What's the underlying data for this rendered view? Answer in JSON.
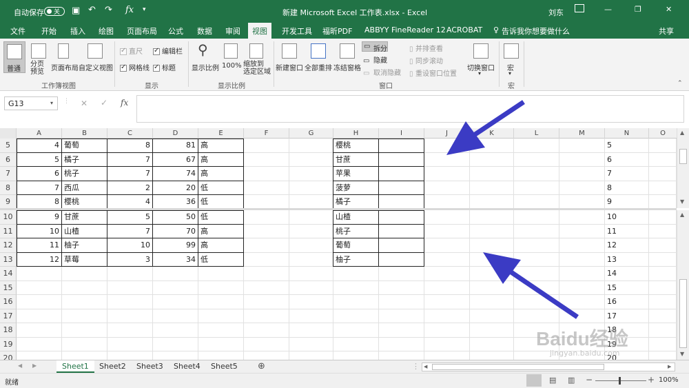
{
  "window": {
    "autosave_label": "自动保存",
    "autosave_state": "关",
    "title": "新建 Microsoft Excel 工作表.xlsx - Excel",
    "user": "刘东",
    "minimize": "—",
    "restore": "❐",
    "close": "✕"
  },
  "tabs": [
    "文件",
    "开始",
    "插入",
    "绘图",
    "页面布局",
    "公式",
    "数据",
    "审阅",
    "视图",
    "开发工具",
    "福昕PDF",
    "ABBYY FineReader 12",
    "ACROBAT"
  ],
  "tell_me": "告诉我你想要做什么",
  "share": "共享",
  "ribbon": {
    "views": {
      "normal": "普通",
      "page_break": "分页\n预览",
      "page_layout": "页面布局",
      "custom": "自定义视图",
      "group": "工作簿视图"
    },
    "show": {
      "ruler": "直尺",
      "formula_bar": "编辑栏",
      "gridlines": "网格线",
      "headings": "标题",
      "group": "显示"
    },
    "zoom": {
      "zoom": "显示比例",
      "zoom100": "100%",
      "zoom_sel": "缩放到\n选定区域",
      "group": "显示比例"
    },
    "window": {
      "new": "新建窗口",
      "arrange": "全部重排",
      "freeze": "冻结窗格",
      "split": "拆分",
      "hide": "隐藏",
      "unhide": "取消隐藏",
      "side": "并排查看",
      "sync": "同步滚动",
      "reset": "重设窗口位置",
      "switch": "切换窗口",
      "group": "窗口"
    },
    "macro": {
      "macro": "宏",
      "group": "宏"
    }
  },
  "formula": {
    "namebox": "G13",
    "cancel": "✕",
    "enter": "✓",
    "fx": "fx",
    "value": ""
  },
  "columns": [
    "A",
    "B",
    "C",
    "D",
    "E",
    "F",
    "G",
    "H",
    "I",
    "J",
    "K",
    "L",
    "M",
    "N",
    "O"
  ],
  "top_rows": [
    {
      "n": "5",
      "a": "4",
      "b": "葡萄",
      "c": "8",
      "d": "81",
      "e": "高",
      "h": "樱桃"
    },
    {
      "n": "6",
      "a": "5",
      "b": "橘子",
      "c": "7",
      "d": "67",
      "e": "高",
      "h": "甘蔗"
    },
    {
      "n": "7",
      "a": "6",
      "b": "桃子",
      "c": "7",
      "d": "74",
      "e": "高",
      "h": "苹果"
    },
    {
      "n": "8",
      "a": "7",
      "b": "西瓜",
      "c": "2",
      "d": "20",
      "e": "低",
      "h": "菠萝"
    },
    {
      "n": "9",
      "a": "8",
      "b": "樱桃",
      "c": "4",
      "d": "36",
      "e": "低",
      "h": "橘子"
    }
  ],
  "bottom_rows": [
    {
      "n": "10",
      "a": "9",
      "b": "甘蔗",
      "c": "5",
      "d": "50",
      "e": "低",
      "h": "山楂"
    },
    {
      "n": "11",
      "a": "10",
      "b": "山楂",
      "c": "7",
      "d": "70",
      "e": "高",
      "h": "桃子"
    },
    {
      "n": "12",
      "a": "11",
      "b": "柚子",
      "c": "10",
      "d": "99",
      "e": "高",
      "h": "葡萄"
    },
    {
      "n": "13",
      "a": "12",
      "b": "草莓",
      "c": "3",
      "d": "34",
      "e": "低",
      "h": "柚子"
    },
    {
      "n": "14"
    },
    {
      "n": "15"
    },
    {
      "n": "16"
    },
    {
      "n": "17"
    },
    {
      "n": "18"
    },
    {
      "n": "19"
    },
    {
      "n": "20"
    }
  ],
  "sheets": [
    "Sheet1",
    "Sheet2",
    "Sheet3",
    "Sheet4",
    "Sheet5"
  ],
  "add_sheet": "⊕",
  "status": {
    "ready": "就绪",
    "zoom": "100%"
  },
  "accent": "#217346",
  "arrow_color": "#3b3bc4",
  "watermark": "Baidu经验",
  "watermark_sub": "jingyan.baidu.com"
}
